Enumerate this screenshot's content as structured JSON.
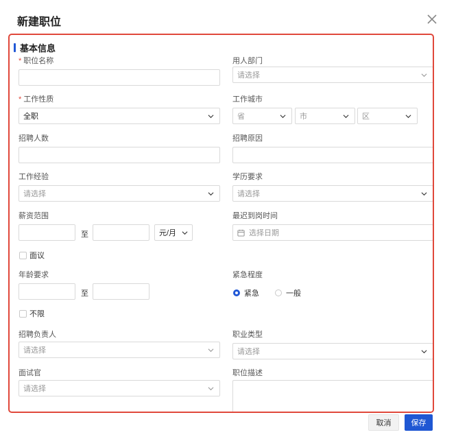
{
  "dialog": {
    "title": "新建职位",
    "close_icon": "close-icon"
  },
  "section": {
    "title": "基本信息"
  },
  "required_mark": "*",
  "fields": {
    "position_name": {
      "label": "职位名称",
      "value": ""
    },
    "department": {
      "label": "用人部门",
      "placeholder": "请选择"
    },
    "job_nature": {
      "label": "工作性质",
      "value": "全职"
    },
    "work_city": {
      "label": "工作城市",
      "province": "省",
      "city": "市",
      "district": "区"
    },
    "headcount": {
      "label": "招聘人数",
      "value": ""
    },
    "reason": {
      "label": "招聘原因",
      "value": ""
    },
    "experience": {
      "label": "工作经验",
      "placeholder": "请选择"
    },
    "education": {
      "label": "学历要求",
      "placeholder": "请选择"
    },
    "salary": {
      "label": "薪资范围",
      "to": "至",
      "unit": "元/月",
      "negotiable": "面议"
    },
    "deadline": {
      "label": "最迟到岗时间",
      "placeholder": "选择日期"
    },
    "age": {
      "label": "年龄要求",
      "to": "至",
      "unlimited": "不限"
    },
    "urgency": {
      "label": "紧急程度",
      "options": [
        "紧急",
        "一般"
      ],
      "selected": "紧急"
    },
    "recruiter": {
      "label": "招聘负责人",
      "placeholder": "请选择"
    },
    "job_type": {
      "label": "职业类型",
      "placeholder": "请选择"
    },
    "interviewer": {
      "label": "面试官",
      "placeholder": "请选择"
    },
    "description": {
      "label": "职位描述",
      "value": ""
    }
  },
  "footer": {
    "cancel": "取消",
    "save": "保存"
  },
  "colors": {
    "accent": "#1f57d3",
    "highlight_border": "#e0473a"
  }
}
